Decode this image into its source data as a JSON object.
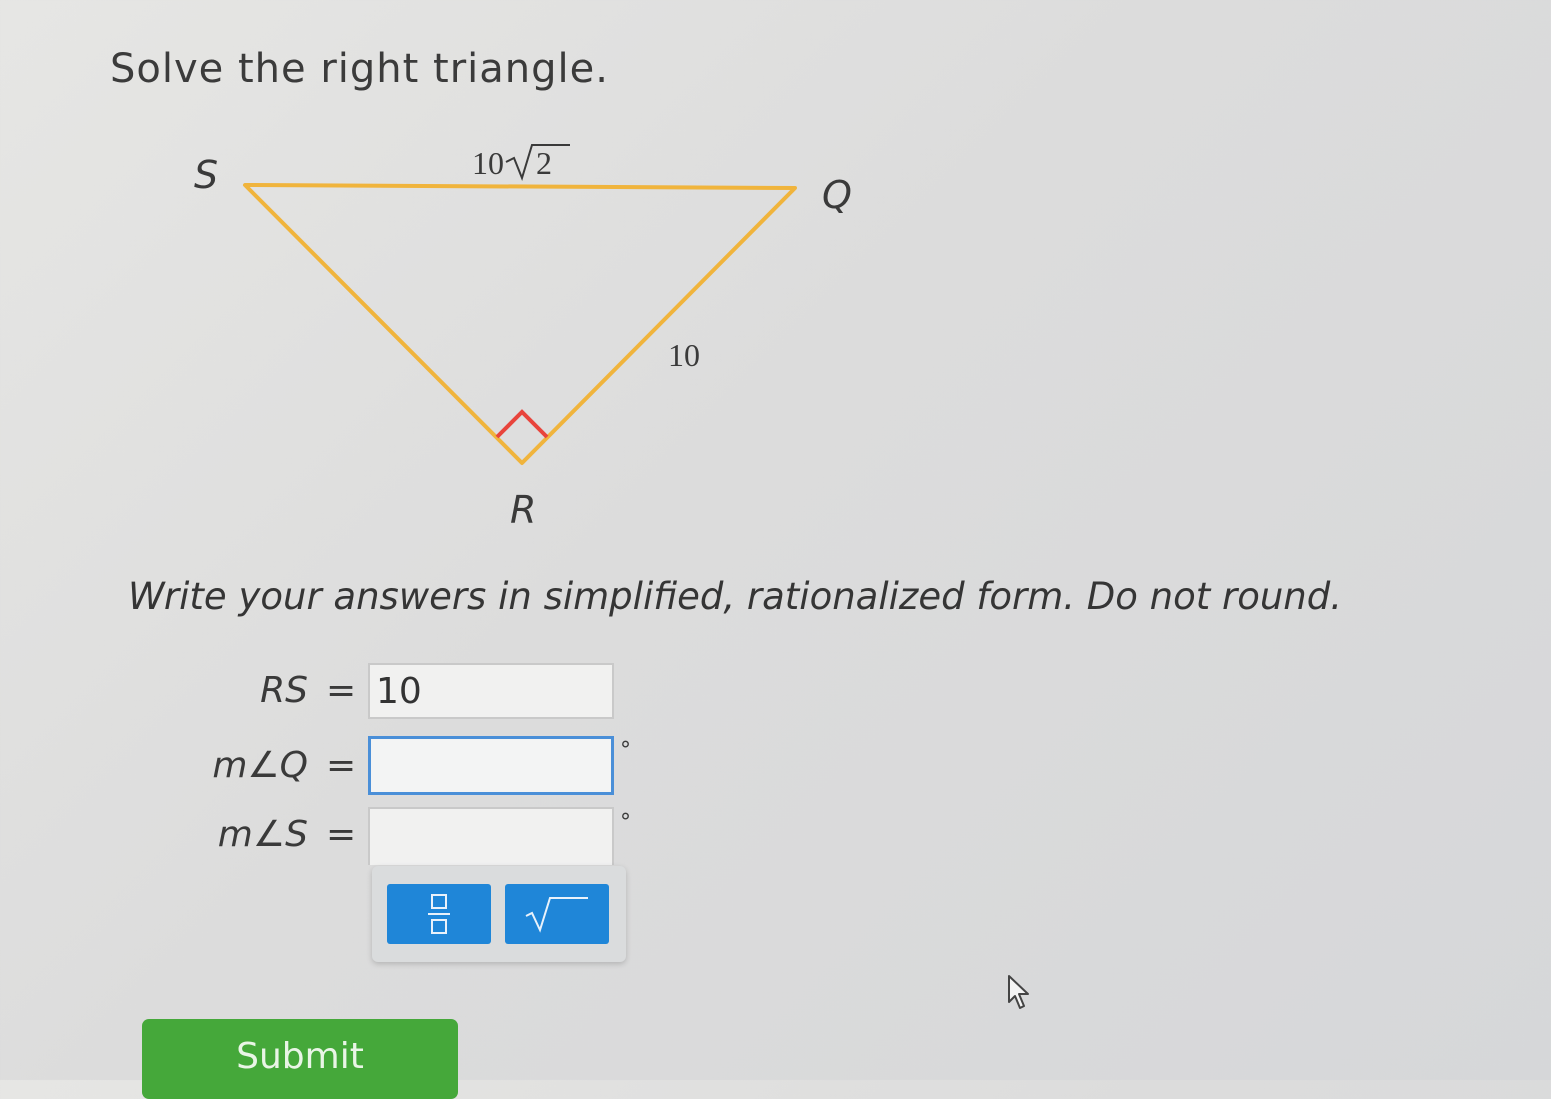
{
  "prompt": "Solve the right triangle.",
  "figure": {
    "vertices": {
      "s": "S",
      "q": "Q",
      "r": "R"
    },
    "side_labels": {
      "sq_coef": "10",
      "sq_radicand": "2",
      "rq": "10"
    },
    "colors": {
      "triangle": "#f0b43c",
      "right_angle": "#e8443c"
    }
  },
  "instruction": "Write your answers in simplified, rationalized form. Do not round.",
  "answers": [
    {
      "label": "RS",
      "equals": "=",
      "value": "10",
      "unit": ""
    },
    {
      "label": "m∠Q",
      "equals": "=",
      "value": "",
      "unit": "°"
    },
    {
      "label": "m∠S",
      "equals": "=",
      "value": "",
      "unit": "°"
    }
  ],
  "toolbar": {
    "fraction_icon": "fraction-icon",
    "sqrt_icon": "square-root-icon",
    "button_color": "#1f86d8"
  },
  "submit_label": "Submit",
  "submit_color": "#45a83a"
}
